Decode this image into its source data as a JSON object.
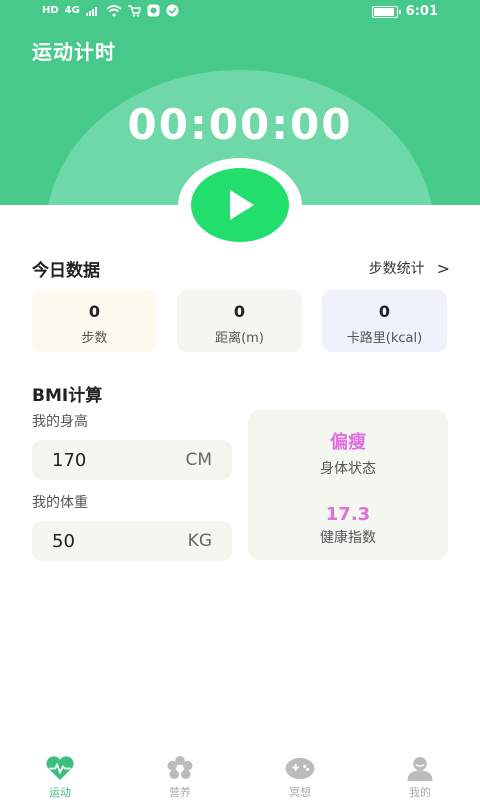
{
  "status_bar": {
    "left_labels": [
      "HD",
      "4G"
    ],
    "time": "6:01",
    "battery_level": 0.85
  },
  "header": {
    "title": "运动计时",
    "timer": "00:00:00"
  },
  "today": {
    "title": "今日数据",
    "link_label": "步数统计",
    "link_chevron": ">",
    "stats": [
      {
        "value": "0",
        "label": "步数",
        "bg": "#fcfaee"
      },
      {
        "value": "0",
        "label": "距离(m)",
        "bg": "#f3f7ef"
      },
      {
        "value": "0",
        "label": "卡路里(kcal)",
        "bg": "#edf2fb"
      }
    ]
  },
  "bmi": {
    "title": "BMI计算",
    "height_label": "我的身高",
    "height_value": "170",
    "height_unit": "CM",
    "weight_label": "我的体重",
    "weight_value": "50",
    "weight_unit": "KG",
    "status": "偏瘦",
    "status_label": "身体状态",
    "index": "17.3",
    "index_label": "健康指数",
    "accent_color": "#e26fe0"
  },
  "tabs": [
    {
      "label": "运动",
      "icon": "heart-pulse-icon",
      "active": true
    },
    {
      "label": "营养",
      "icon": "flower-icon",
      "active": false
    },
    {
      "label": "冥想",
      "icon": "gamepad-icon",
      "active": false
    },
    {
      "label": "我的",
      "icon": "person-icon",
      "active": false
    }
  ],
  "colors": {
    "header": "#48c98c",
    "play": "#22de6c",
    "active_tab": "#3bbf7e",
    "inactive_tab": "#bbbbbb"
  }
}
